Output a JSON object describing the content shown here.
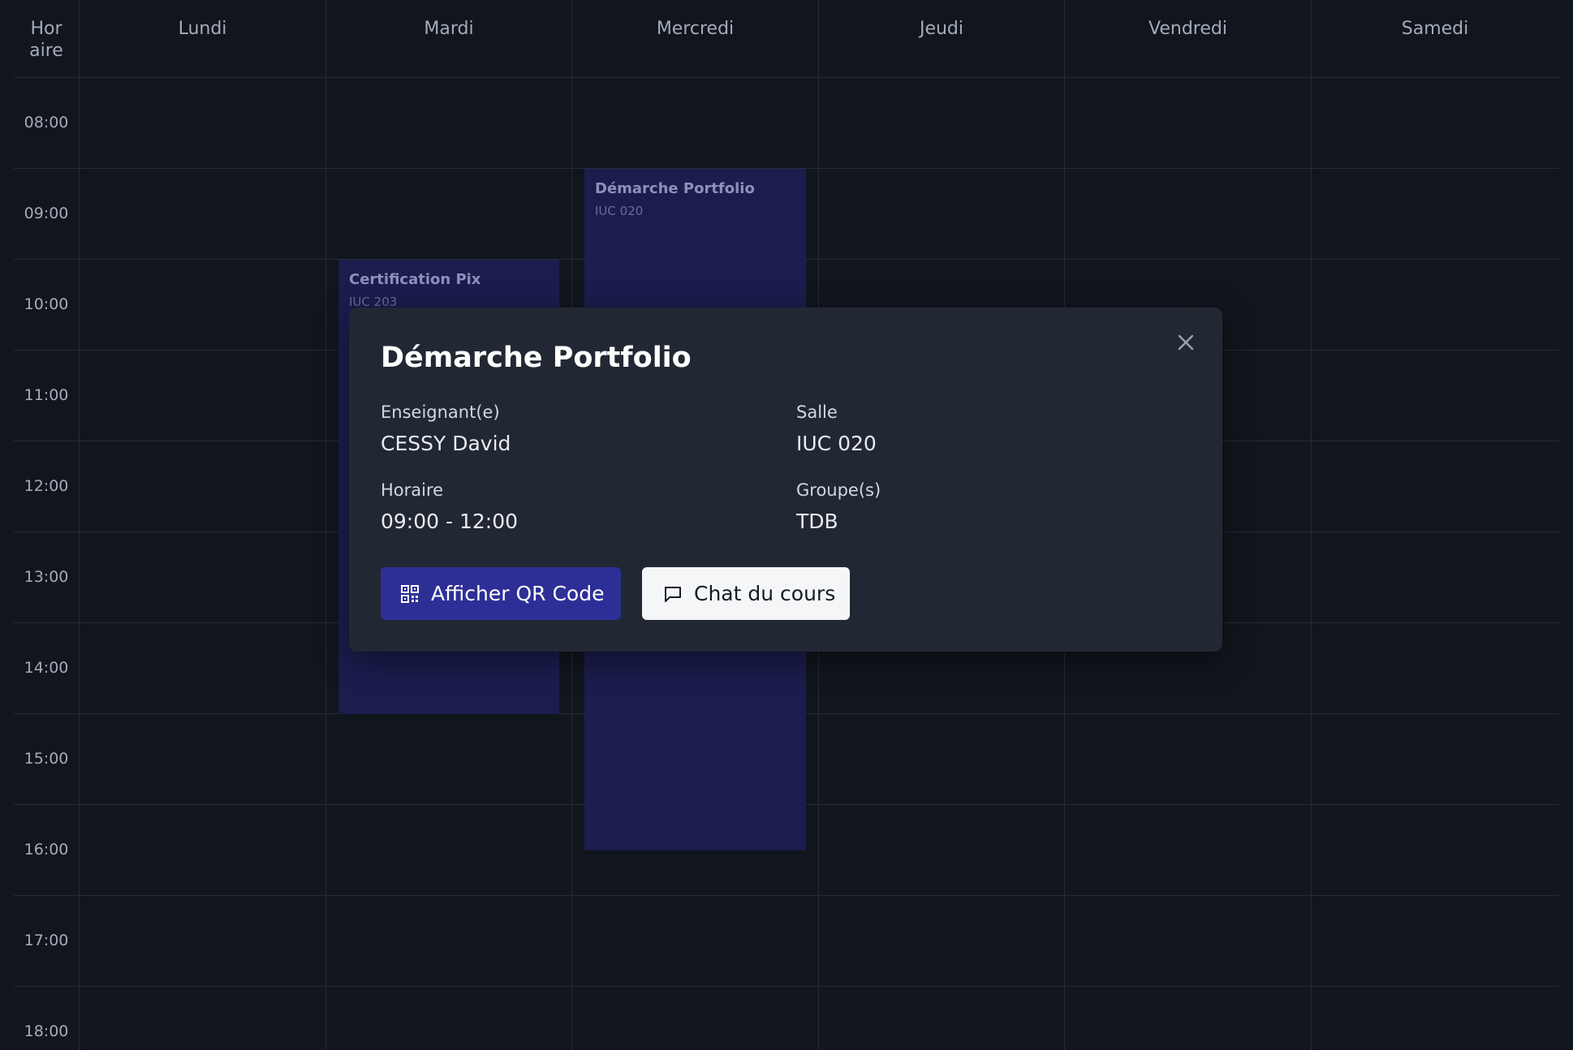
{
  "calendar": {
    "time_header_line1": "Hor",
    "time_header_line2": "aire",
    "days": [
      "Lundi",
      "Mardi",
      "Mercredi",
      "Jeudi",
      "Vendredi",
      "Samedi"
    ],
    "hours": [
      "08:00",
      "09:00",
      "10:00",
      "11:00",
      "12:00",
      "13:00",
      "14:00",
      "15:00",
      "16:00",
      "17:00",
      "18:00"
    ]
  },
  "events": [
    {
      "title": "Certification Pix",
      "room": "IUC 203",
      "day": "Mardi",
      "start": "10:00",
      "end": "14:00"
    },
    {
      "title": "Démarche Portfolio",
      "room": "IUC 020",
      "day": "Mercredi",
      "start": "09:00",
      "end": "16:00"
    }
  ],
  "modal": {
    "title": "Démarche Portfolio",
    "teacher_label": "Enseignant(e)",
    "teacher_value": "CESSY David",
    "room_label": "Salle",
    "room_value": "IUC 020",
    "time_label": "Horaire",
    "time_value": "09:00 - 12:00",
    "groups_label": "Groupe(s)",
    "groups_value": "TDB",
    "qr_button": "Afficher QR Code",
    "chat_button": "Chat du cours",
    "close_icon": "close-icon",
    "qr_icon": "qr-code-icon",
    "chat_icon": "message-square-icon"
  }
}
